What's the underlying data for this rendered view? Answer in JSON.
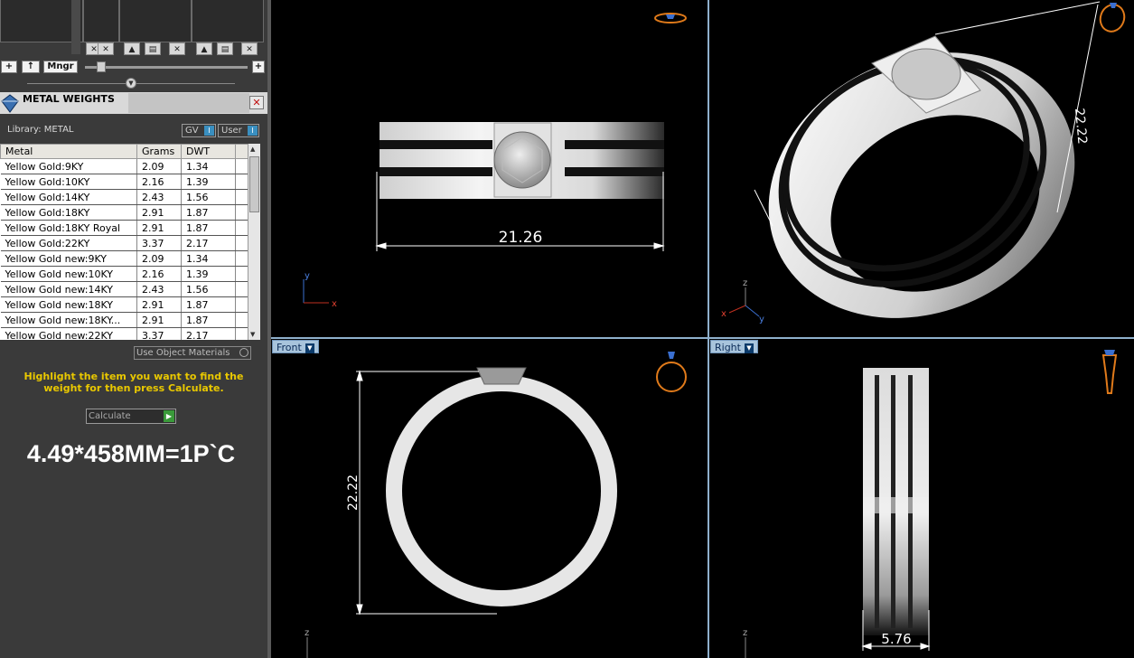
{
  "toolbar": {
    "add_label": "+",
    "up_label": "↑",
    "manager_label": "Mngr",
    "plus_label": "+"
  },
  "metal_weights": {
    "title": "METAL WEIGHTS",
    "library_label": "Library: METAL",
    "toggle_gv": "GV",
    "toggle_user": "User",
    "toggle_on": "I",
    "columns": [
      "Metal",
      "Grams",
      "DWT"
    ],
    "rows": [
      [
        "Yellow Gold:9KY",
        "2.09",
        "1.34"
      ],
      [
        "Yellow Gold:10KY",
        "2.16",
        "1.39"
      ],
      [
        "Yellow Gold:14KY",
        "2.43",
        "1.56"
      ],
      [
        "Yellow Gold:18KY",
        "2.91",
        "1.87"
      ],
      [
        "Yellow Gold:18KY Royal",
        "2.91",
        "1.87"
      ],
      [
        "Yellow Gold:22KY",
        "3.37",
        "2.17"
      ],
      [
        "Yellow Gold new:9KY",
        "2.09",
        "1.34"
      ],
      [
        "Yellow Gold new:10KY",
        "2.16",
        "1.39"
      ],
      [
        "Yellow Gold new:14KY",
        "2.43",
        "1.56"
      ],
      [
        "Yellow Gold new:18KY",
        "2.91",
        "1.87"
      ],
      [
        "Yellow Gold new:18KY...",
        "2.91",
        "1.87"
      ],
      [
        "Yellow Gold new:22KY",
        "3.37",
        "2.17"
      ]
    ],
    "use_object_materials": "Use Object Materials",
    "hint": "Highlight the item you want to find the weight for then press Calculate.",
    "calculate_label": "Calculate",
    "result_text": "4.49*458MM=1P`C"
  },
  "viewports": {
    "top": {
      "dimension": "21.26",
      "axis_x": "x",
      "axis_y": "y"
    },
    "perspective": {
      "dimension": "22.22",
      "axis_x": "x",
      "axis_y": "y",
      "axis_z": "z"
    },
    "front": {
      "label": "Front",
      "dimension": "22.22",
      "axis_z": "z"
    },
    "right": {
      "label": "Right",
      "dimension": "5.76",
      "axis_z": "z"
    }
  },
  "colors": {
    "panel_bg": "#3a3a3a",
    "hint_yellow": "#e9c800",
    "viewport_label_bg": "#a8c4dc",
    "ring_icon_orange": "#e07a1a"
  }
}
